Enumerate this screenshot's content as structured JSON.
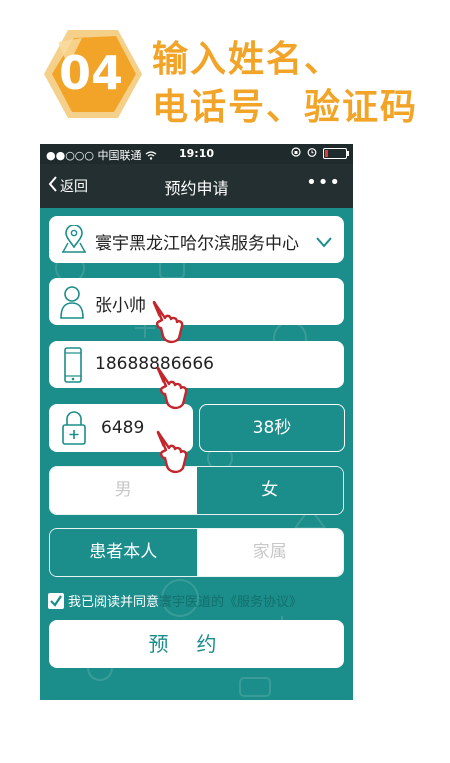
{
  "step": {
    "number": "04",
    "title_line1": "输入姓名、",
    "title_line2": "电话号、验证码"
  },
  "statusbar": {
    "carrier": "●●○○○ 中国联通",
    "time": "19:10"
  },
  "navbar": {
    "back_label": "返回",
    "title": "预约申请",
    "more_label": "•••"
  },
  "form": {
    "center_value": "寰宇黑龙江哈尔滨服务中心",
    "name_value": "张小帅",
    "phone_value": "18688886666",
    "code_value": "6489",
    "countdown_label": "38秒",
    "gender": {
      "options": [
        "男",
        "女"
      ],
      "selected": "女"
    },
    "patient_type": {
      "options": [
        "患者本人",
        "家属"
      ],
      "selected": "患者本人"
    },
    "agreement": {
      "checked": true,
      "text": "我已阅读并同意",
      "link": "寰宇医道的《服务协议》"
    },
    "submit_label": "预约"
  },
  "colors": {
    "accent": "#1b8d8a",
    "title_orange": "#f2a428",
    "navbar": "#232f31",
    "hand_red": "#c3262c"
  }
}
